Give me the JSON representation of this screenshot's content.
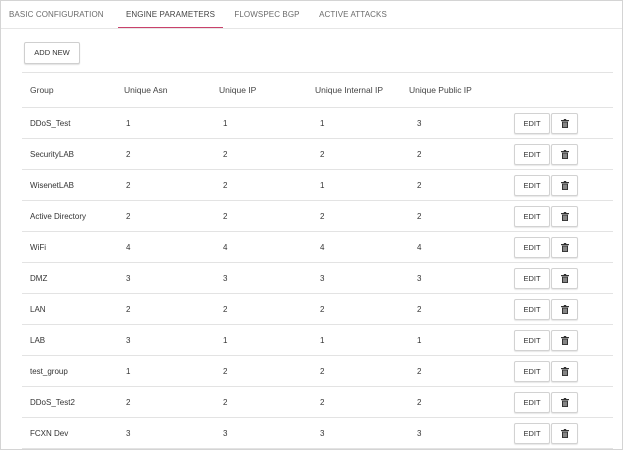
{
  "tabs": [
    {
      "label": "BASIC CONFIGURATION",
      "active": false
    },
    {
      "label": "ENGINE PARAMETERS",
      "active": true
    },
    {
      "label": "FLOWSPEC BGP",
      "active": false
    },
    {
      "label": "ACTIVE ATTACKS",
      "active": false
    }
  ],
  "toolbar": {
    "add_label": "ADD NEW"
  },
  "table": {
    "headers": [
      "Group",
      "Unique Asn",
      "Unique IP",
      "Unique Internal IP",
      "Unique Public IP"
    ],
    "rows": [
      {
        "group": "DDoS_Test",
        "asn": "1",
        "ip": "1",
        "internal": "1",
        "public": "3"
      },
      {
        "group": "SecurityLAB",
        "asn": "2",
        "ip": "2",
        "internal": "2",
        "public": "2"
      },
      {
        "group": "WisenetLAB",
        "asn": "2",
        "ip": "2",
        "internal": "1",
        "public": "2"
      },
      {
        "group": "Active Directory",
        "asn": "2",
        "ip": "2",
        "internal": "2",
        "public": "2"
      },
      {
        "group": "WiFi",
        "asn": "4",
        "ip": "4",
        "internal": "4",
        "public": "4"
      },
      {
        "group": "DMZ",
        "asn": "3",
        "ip": "3",
        "internal": "3",
        "public": "3"
      },
      {
        "group": "LAN",
        "asn": "2",
        "ip": "2",
        "internal": "2",
        "public": "2"
      },
      {
        "group": "LAB",
        "asn": "3",
        "ip": "1",
        "internal": "1",
        "public": "1"
      },
      {
        "group": "test_group",
        "asn": "1",
        "ip": "2",
        "internal": "2",
        "public": "2"
      },
      {
        "group": "DDoS_Test2",
        "asn": "2",
        "ip": "2",
        "internal": "2",
        "public": "2"
      },
      {
        "group": "FCXN Dev",
        "asn": "3",
        "ip": "3",
        "internal": "3",
        "public": "3"
      }
    ],
    "row_actions": {
      "edit_label": "EDIT",
      "delete_icon": "trash-icon"
    }
  },
  "colors": {
    "active_tab_underline": "#c9426b",
    "border": "#e3e3e3",
    "text": "#333333"
  }
}
